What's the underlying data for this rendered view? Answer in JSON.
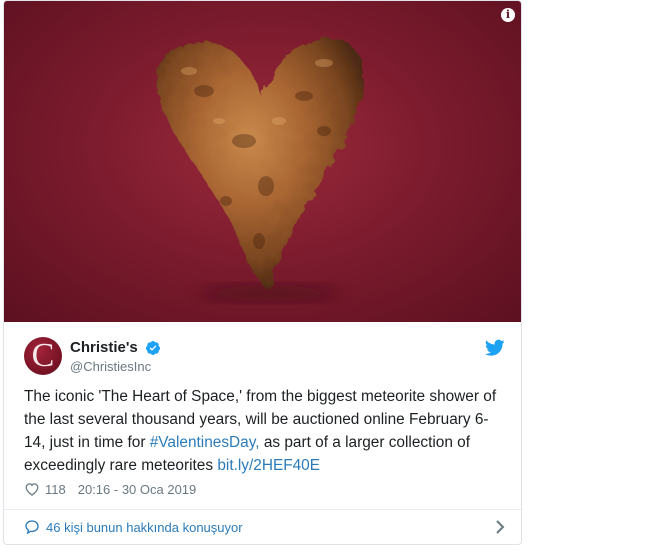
{
  "tweet": {
    "author": {
      "name": "Christie's",
      "handle": "@ChristiesInc",
      "avatar_letter": "C",
      "verified": true
    },
    "text_parts": {
      "before_hashtag": "The iconic 'The Heart of Space,' from the biggest meteorite shower of the last several thousand years, will be auctioned online February 6-14, just in time for ",
      "hashtag": "#ValentinesDay,",
      "after_hashtag": " as part of a larger collection of exceedingly rare meteorites ",
      "link": "bit.ly/2HEF40E"
    },
    "likes": "118",
    "timestamp": "20:16 - 30 Oca 2019",
    "conversation_label": "46 kişi bunun hakkında konuşuyor",
    "info_glyph": "i"
  },
  "icons": {
    "info": "info-icon",
    "verified": "verified-badge-icon",
    "twitter": "twitter-bird-icon",
    "like": "heart-icon",
    "reply": "speech-bubble-icon",
    "chevron": "chevron-right-icon"
  },
  "colors": {
    "link": "#2b7bb9",
    "background_media": "#7d1c2e",
    "verified": "#1da1f2",
    "secondary_text": "#697882"
  }
}
